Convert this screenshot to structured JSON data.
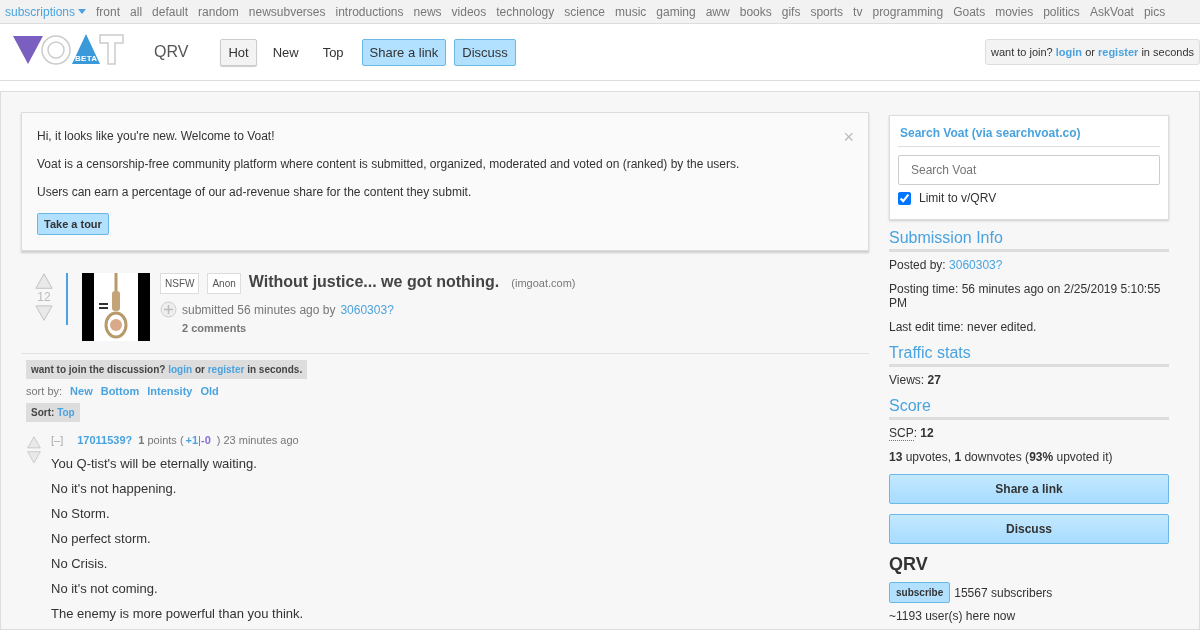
{
  "top_nav": {
    "subscriptions": "subscriptions",
    "links": [
      "front",
      "all",
      "default",
      "random",
      "newsubverses",
      "introductions",
      "news",
      "videos",
      "technology",
      "science",
      "music",
      "gaming",
      "aww",
      "books",
      "gifs",
      "sports",
      "tv",
      "programming",
      "Goats",
      "movies",
      "politics",
      "AskVoat",
      "pics"
    ]
  },
  "header": {
    "logo_badge": "BETA",
    "subverse": "QRV",
    "tabs": [
      {
        "label": "Hot",
        "selected": true
      },
      {
        "label": "New",
        "selected": false
      },
      {
        "label": "Top",
        "selected": false
      }
    ],
    "actions": [
      "Share a link",
      "Discuss"
    ],
    "join": {
      "prefix": "want to join?",
      "login": "login",
      "or": "or",
      "register": "register",
      "suffix": "in seconds"
    }
  },
  "welcome": {
    "close": "×",
    "lines": [
      "Hi, it looks like you're new. Welcome to Voat!",
      "Voat is a censorship-free community platform where content is submitted, organized, moderated and voted on (ranked) by the users.",
      "Users can earn a percentage of our ad-revenue share for the content they submit."
    ],
    "button": "Take a tour"
  },
  "post": {
    "score": "12",
    "thumbnail": {
      "kind": "picture"
    },
    "tags": [
      "NSFW",
      "Anon"
    ],
    "title": "Without justice... we got nothing.",
    "domain": "(imgoat.com)",
    "submitted": "submitted 56 minutes ago by",
    "author": "3060303?",
    "comments": "2 comments"
  },
  "join_discussion": {
    "prefix": "want to join the discussion?",
    "login": "login",
    "or": "or",
    "register": "register",
    "suffix": "in seconds."
  },
  "sort_by": {
    "label": "sort by:",
    "options": [
      "New",
      "Bottom",
      "Intensity",
      "Old"
    ]
  },
  "sort": {
    "label": "Sort:",
    "value": "Top"
  },
  "comment": {
    "toggle": "[–]",
    "author": "17011539?",
    "points": "**1** points (",
    "up": "+1",
    "separator": "|",
    "down": "-0",
    "time": ") 23 minutes ago",
    "lines": [
      "You Q-tist's will be eternally waiting.",
      "No it's not happening.",
      "No Storm.",
      "No perfect storm.",
      "No Crisis.",
      "No it's not coming.",
      "The enemy is more powerful than you think."
    ]
  },
  "sidebar": {
    "search": {
      "title": "Search Voat (via searchvoat.co)",
      "placeholder": "Search Voat",
      "limit_label": "Limit to v/QRV",
      "limit_checked": true
    },
    "submission_info": {
      "heading": "Submission Info",
      "posted_by": "Posted by:",
      "author": "3060303?",
      "posting_time": "Posting time: 56 minutes ago on 2/25/2019 5:10:55 PM",
      "last_edit": "Last edit time: never edited."
    },
    "traffic": {
      "heading": "Traffic stats",
      "views": "Views: **27**"
    },
    "score": {
      "heading": "Score",
      "scp_label": "SCP",
      "scp_value": ": **12**",
      "votes": "**13** upvotes, **1** downvotes (**93%** upvoted it)"
    },
    "buttons": [
      "Share a link",
      "Discuss"
    ],
    "subverse": {
      "name": "QRV",
      "subscribe": "subscribe",
      "subscribers": "15567 subscribers",
      "online": "~1193 user(s) here now"
    }
  }
}
